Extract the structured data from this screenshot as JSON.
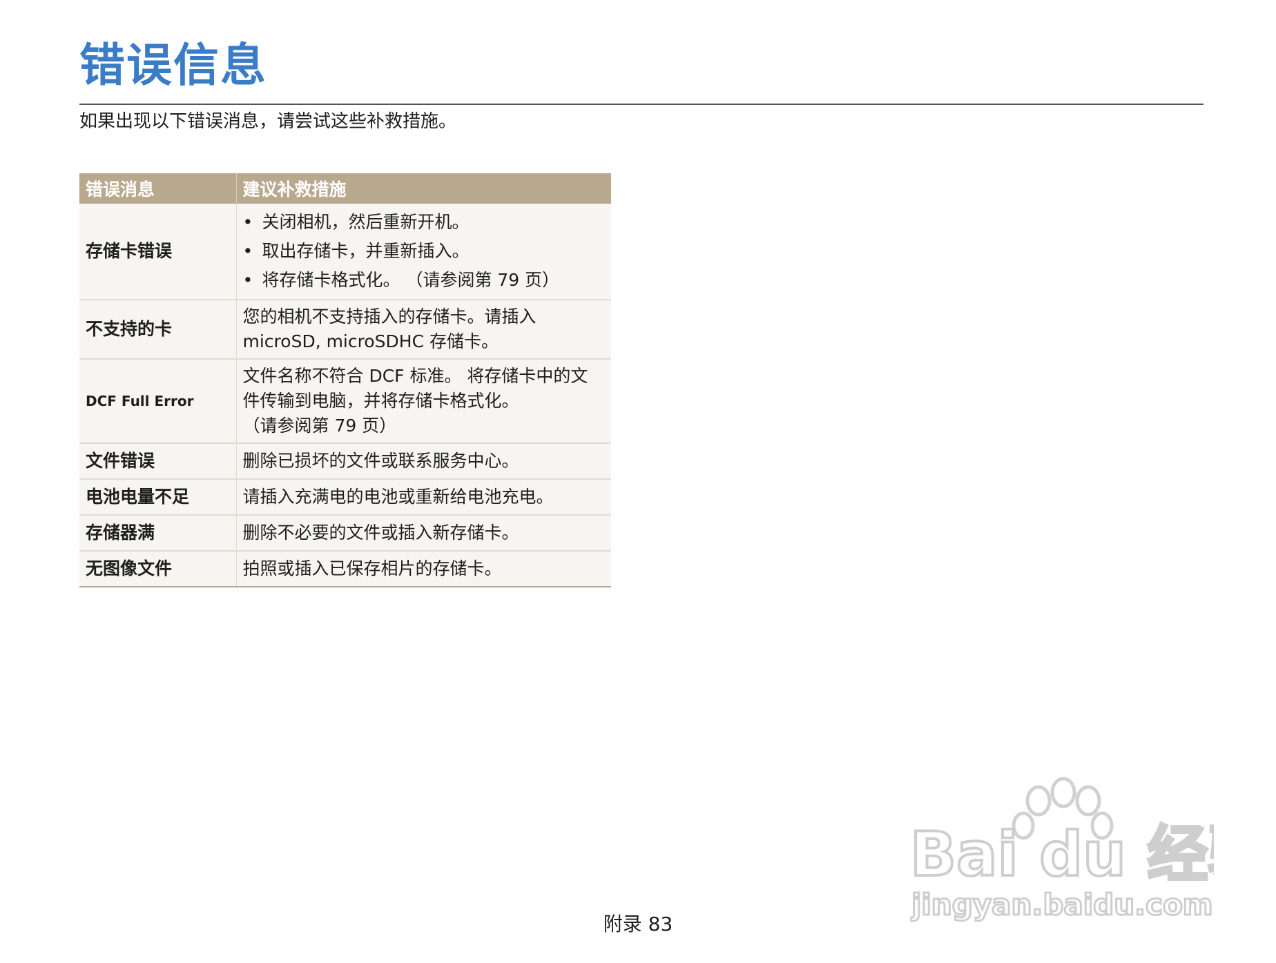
{
  "page": {
    "title": "错误信息",
    "intro": "如果出现以下错误消息，请尝试这些补救措施。",
    "footer": "附录  83"
  },
  "table": {
    "headers": [
      "错误消息",
      "建议补救措施"
    ],
    "rows": [
      {
        "key": "存储卡错误",
        "bullets": [
          "关闭相机，然后重新开机。",
          "取出存储卡，并重新插入。",
          "将存储卡格式化。 （请参阅第 79 页）"
        ]
      },
      {
        "key": "不支持的卡",
        "lines": [
          "您的相机不支持插入的存储卡。请插入",
          "microSD, microSDHC 存储卡。"
        ]
      },
      {
        "key": "DCF Full Error",
        "lines": [
          "文件名称不符合 DCF 标准。 将存储卡中的文",
          "件传输到电脑，并将存储卡格式化。",
          "（请参阅第 79 页）"
        ]
      },
      {
        "key": "文件错误",
        "lines": [
          "删除已损坏的文件或联系服务中心。"
        ]
      },
      {
        "key": "电池电量不足",
        "lines": [
          "请插入充满电的电池或重新给电池充电。"
        ]
      },
      {
        "key": "存储器满",
        "lines": [
          "删除不必要的文件或插入新存储卡。"
        ]
      },
      {
        "key": "无图像文件",
        "lines": [
          "拍照或插入已保存相片的存储卡。"
        ]
      }
    ]
  },
  "watermark": {
    "brand": "Bai du 经验",
    "url": "jingyan.baidu.com"
  }
}
